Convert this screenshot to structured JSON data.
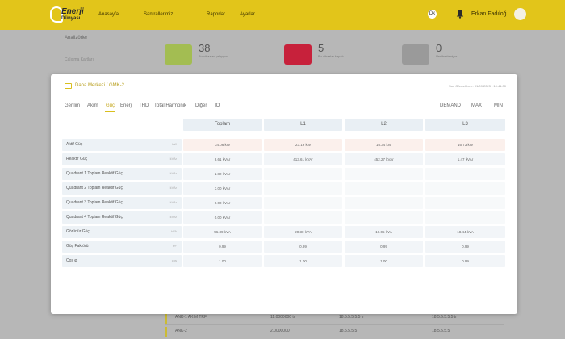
{
  "topbar": {
    "logo_line1": "Enerji",
    "logo_line2": "Dünyası",
    "nav": [
      "Anasayfa",
      "Santrallerimiz",
      "Raporlar",
      "Ayarlar"
    ],
    "bell_badge": "Dk",
    "user_name": "Erkan Fadıloğ"
  },
  "background": {
    "sidebar_label": "Analizörler",
    "sidebar_sub": "Çalışma Kartları",
    "stats": [
      {
        "value": "38",
        "label": "Bu cihazlar çalışıyor",
        "color": "#a3bd52"
      },
      {
        "value": "5",
        "label": "Bu cihazlar kapalı",
        "color": "#c7213b"
      },
      {
        "value": "0",
        "label": "Veri bekleniyor",
        "color": "#9a9a9a"
      }
    ],
    "rows": [
      {
        "name": "ANK-1 AKIM TRF",
        "c1": "11.0000000 tr",
        "c2": "18.5.5.5.5.5 tr",
        "c3": "18.5.5.5.5.5 tr"
      },
      {
        "name": "ANK-2",
        "c1": "2.0000000",
        "c2": "18.5.5.5.5",
        "c3": "18.5.5.5.5"
      }
    ]
  },
  "modal": {
    "title": "Daha Merkezi / GMK-2",
    "timestamp": "Son Güncelleme: 01/09/2023 - 10:41:00",
    "tabs": [
      "Gerilim",
      "Akım",
      "Güç",
      "Enerji",
      "THD",
      "Total Harmonik",
      "Diğer",
      "IO"
    ],
    "active_tab": "Güç",
    "modes": [
      "DEMAND",
      "MAX",
      "MIN"
    ],
    "columns": [
      "Toplam",
      "L1",
      "L2",
      "L3"
    ],
    "rows": [
      {
        "label": "Aktif Güç",
        "unit": "kW",
        "values": [
          "34.06 kW",
          "23.19 kW",
          "16.34 kW",
          "16.73 kW"
        ],
        "style": "hl"
      },
      {
        "label": "Reaktif Güç",
        "unit": "kVAr",
        "values": [
          "8.61 kVAr",
          "413.61 kVAr",
          "452.27 kVAr",
          "1.47 kVAr"
        ],
        "style": "nm"
      },
      {
        "label": "Quadrant 1 Toplam Reaktif Güç",
        "unit": "kVAr",
        "values": [
          "2.82 kVAr",
          "",
          "",
          ""
        ],
        "style": "nm"
      },
      {
        "label": "Quadrant 2 Toplam Reaktif Güç",
        "unit": "kVAr",
        "values": [
          "3.00 kVAr",
          "",
          "",
          ""
        ],
        "style": "nm"
      },
      {
        "label": "Quadrant 3 Toplam Reaktif Güç",
        "unit": "kVAr",
        "values": [
          "0.00 kVAr",
          "",
          "",
          ""
        ],
        "style": "nm"
      },
      {
        "label": "Quadrant 4 Toplam Reaktif Güç",
        "unit": "kVAr",
        "values": [
          "0.00 kVAr",
          "",
          "",
          ""
        ],
        "style": "nm"
      },
      {
        "label": "Görünür Güç",
        "unit": "kVA",
        "values": [
          "56.39 kVA",
          "20.30 kVA",
          "16.05 kVA",
          "18.44 kVA"
        ],
        "style": "nm"
      },
      {
        "label": "Güç Faktörü",
        "unit": "PF",
        "values": [
          "0.99",
          "0.99",
          "0.99",
          "0.99"
        ],
        "style": "nm"
      },
      {
        "label": "Cos φ",
        "unit": "cos",
        "values": [
          "1.00",
          "1.00",
          "1.00",
          "0.99"
        ],
        "style": "nm"
      }
    ]
  },
  "colors": {
    "accent": "#e2c51a",
    "highlight_row": "#fbf0ec",
    "header_bg": "#e9eff4"
  }
}
